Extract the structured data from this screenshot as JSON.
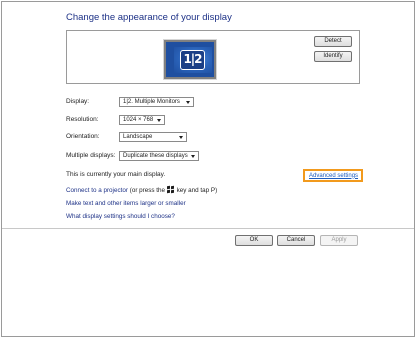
{
  "title": "Change the appearance of your display",
  "preview": {
    "monitor_label": "1|2",
    "detect_label": "Detect",
    "identify_label": "Identify"
  },
  "settings": {
    "display_label": "Display:",
    "display_value": "1|2. Multiple Monitors",
    "resolution_label": "Resolution:",
    "resolution_value": "1024 × 768",
    "orientation_label": "Orientation:",
    "orientation_value": "Landscape",
    "multiple_label": "Multiple displays:",
    "multiple_value": "Duplicate these displays"
  },
  "main_display_text": "This is currently your main display.",
  "advanced_link": "Advanced settings",
  "links": {
    "projector_link": "Connect to a projector",
    "projector_rest_1": " (or press the ",
    "projector_rest_2": " key and tap P)",
    "text_size_link": "Make text and other items larger or smaller",
    "help_link": "What display settings should I choose?"
  },
  "buttons": {
    "ok": "OK",
    "cancel": "Cancel",
    "apply": "Apply"
  },
  "colors": {
    "title": "#1e3287",
    "highlight": "#f29a1d",
    "monitor": "#1f4fa0"
  },
  "icons": {
    "windows_key": "windows-logo-icon",
    "dropdown": "chevron-down-icon"
  }
}
